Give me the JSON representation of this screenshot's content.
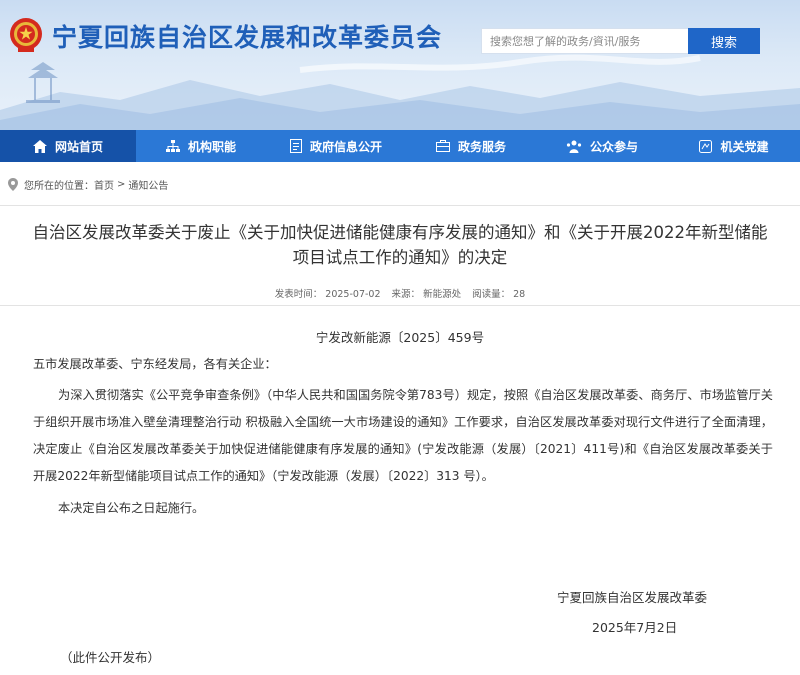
{
  "header": {
    "site_title": "宁夏回族自治区发展和改革委员会",
    "search_placeholder": "搜索您想了解的政务/資讯/服务",
    "search_button": "搜索"
  },
  "nav": [
    {
      "label": "网站首页",
      "icon": "home-icon"
    },
    {
      "label": "机构职能",
      "icon": "org-chart-icon"
    },
    {
      "label": "政府信息公开",
      "icon": "document-icon"
    },
    {
      "label": "政务服务",
      "icon": "service-icon"
    },
    {
      "label": "公众参与",
      "icon": "people-icon"
    },
    {
      "label": "机关党建",
      "icon": "badge-icon"
    }
  ],
  "breadcrumb": {
    "prefix": "您所在的位置：",
    "home": "首页",
    "sep": ">",
    "current": "通知公告"
  },
  "article": {
    "title_line1": "自治区发展改革委关于废止《关于加快促进储能健康有序发展的通知》和《关于开展2022年新型储能",
    "title_line2": "项目试点工作的通知》的决定",
    "publish_time": "发表时间： 2025-07-02",
    "source": "来源： 新能源处",
    "views": "阅读量： 28",
    "doc_number": "宁发改新能源〔2025〕459号",
    "salutation": "五市发展改革委、宁东经发局，各有关企业：",
    "paragraph1": "为深入贯彻落实《公平竞争审查条例》（中华人民共和国国务院令第783号）规定，按照《自治区发展改革委、商务厅、市场监管厅关于组织开展市场准入壁垒清理整治行动 积极融入全国统一大市场建设的通知》工作要求，自治区发展改革委对现行文件进行了全面清理，决定废止《自治区发展改革委关于加快促进储能健康有序发展的通知》(宁发改能源（发展）〔2021〕411号)和《自治区发展改革委关于开展2022年新型储能项目试点工作的通知》（宁发改能源（发展）〔2022〕313 号）。",
    "paragraph2": "本决定自公布之日起施行。",
    "signature_org": "宁夏回族自治区发展改革委",
    "signature_date": "2025年7月2日",
    "release_note": "（此件公开发布）"
  },
  "colors": {
    "title_blue": "#1f5fb8",
    "nav_blue": "#2b78d6",
    "nav_active": "#1552a8",
    "search_button": "#1f66c8"
  }
}
